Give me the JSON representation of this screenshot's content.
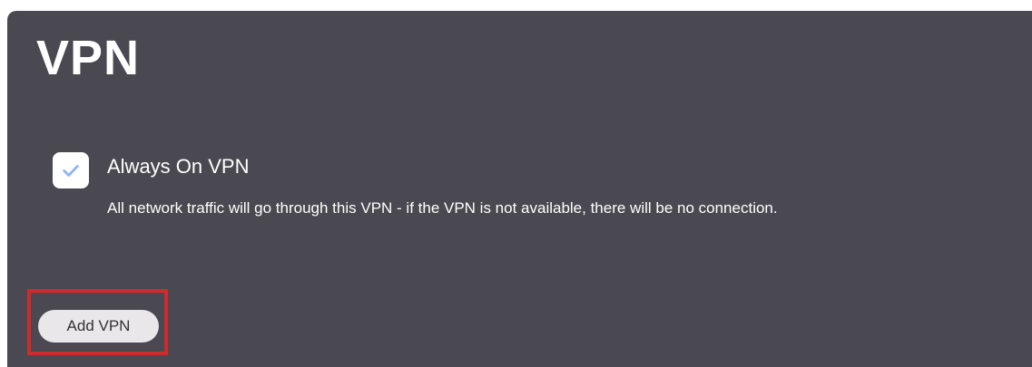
{
  "page": {
    "title": "VPN"
  },
  "always_on_vpn": {
    "label": "Always On VPN",
    "description": "All network traffic will go through this VPN - if the VPN is not available, there will be no connection.",
    "checked": true,
    "icon": "check-icon"
  },
  "actions": {
    "add_vpn_label": "Add VPN"
  },
  "colors": {
    "panel_background": "#4a4951",
    "text": "#ffffff",
    "checkmark": "#8ab4f8",
    "highlight": "#d12a2a",
    "button_background": "#e9e7ea"
  }
}
